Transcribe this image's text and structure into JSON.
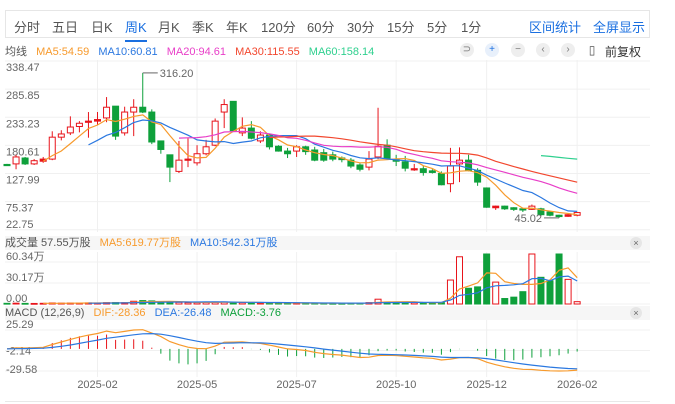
{
  "tabs": [
    {
      "label": "分时"
    },
    {
      "label": "五日"
    },
    {
      "label": "日K"
    },
    {
      "label": "周K",
      "active": true
    },
    {
      "label": "月K"
    },
    {
      "label": "季K"
    },
    {
      "label": "年K"
    },
    {
      "label": "120分"
    },
    {
      "label": "60分"
    },
    {
      "label": "30分"
    },
    {
      "label": "15分"
    },
    {
      "label": "5分"
    },
    {
      "label": "1分"
    }
  ],
  "actions": {
    "range_stats": "区间统计",
    "fullscreen": "全屏显示"
  },
  "ma_legend": {
    "title": "均线",
    "ma5": "MA5:54.59",
    "ma10": "MA10:60.81",
    "ma20": "MA20:94.61",
    "ma30": "MA30:115.55",
    "ma60": "MA60:158.14"
  },
  "controls": {
    "reset": "⊃",
    "zoom_in": "+",
    "zoom_out": "−",
    "prev": "‹",
    "next": "›",
    "bar": "▯",
    "adjust": "前复权"
  },
  "volume_header": {
    "title": "成交量 57.55万股",
    "ma5": "MA5:619.77万股",
    "ma10": "MA10:542.31万股",
    "close": "×"
  },
  "macd_header": {
    "title": "MACD (12,26,9)",
    "dif": "DIF:-28.36",
    "dea": "DEA:-26.48",
    "macd": "MACD:-3.76",
    "close": "×"
  },
  "colors": {
    "up": "#e8141b",
    "down": "#0ea03b",
    "ma5": "#f79a2c",
    "ma10": "#2b78e0",
    "ma20": "#e83ec8",
    "ma30": "#f2472e",
    "ma60": "#2fd08f",
    "accent": "#1a6fe0"
  },
  "chart_data": {
    "type": "candlestick",
    "period": "weekly",
    "price_axis": {
      "ticks": [
        "338.47",
        "285.85",
        "233.23",
        "180.61",
        "127.99",
        "75.37",
        "22.75"
      ],
      "range": [
        22.75,
        338.47
      ]
    },
    "volume_axis": {
      "ticks": [
        "60.34万",
        "30.17万",
        "0.00"
      ],
      "range": [
        0,
        60.34
      ]
    },
    "macd_axis": {
      "ticks": [
        "25.29",
        "-2.14",
        "-29.58"
      ],
      "range": [
        -29.58,
        25.29
      ]
    },
    "x_ticks": [
      {
        "label": "2025-02",
        "index": 10
      },
      {
        "label": "2025-05",
        "index": 21
      },
      {
        "label": "2025-07",
        "index": 32
      },
      {
        "label": "2025-10",
        "index": 43
      },
      {
        "label": "2025-12",
        "index": 53
      },
      {
        "label": "2026-02",
        "index": 63
      }
    ],
    "annotations": {
      "high": {
        "label": "316.20",
        "index": 15
      },
      "low": {
        "label": "45.02",
        "index": 61
      }
    },
    "ohlc": [
      [
        145,
        143,
        146,
        142
      ],
      [
        146,
        159,
        163,
        136
      ],
      [
        157,
        146,
        159,
        144
      ],
      [
        146,
        152,
        155,
        144
      ],
      [
        151,
        155,
        159,
        148
      ],
      [
        155,
        196,
        207,
        153
      ],
      [
        196,
        202,
        209,
        190
      ],
      [
        204,
        215,
        235,
        200
      ],
      [
        216,
        222,
        226,
        205
      ],
      [
        224,
        226,
        243,
        195
      ],
      [
        226,
        229,
        243,
        219
      ],
      [
        232,
        252,
        271,
        224
      ],
      [
        254,
        198,
        254,
        191
      ],
      [
        204,
        243,
        253,
        199
      ],
      [
        243,
        252,
        267,
        198
      ],
      [
        252,
        243,
        316.2,
        241
      ],
      [
        243,
        187,
        248,
        183
      ],
      [
        189,
        173,
        189,
        165
      ],
      [
        163,
        140,
        163,
        112
      ],
      [
        132,
        153,
        189,
        129
      ],
      [
        153,
        155,
        194,
        140
      ],
      [
        148,
        165,
        181,
        143
      ],
      [
        165,
        178,
        191,
        162
      ],
      [
        181,
        226,
        231,
        179
      ],
      [
        243,
        257,
        267,
        213
      ],
      [
        263,
        208,
        263,
        206
      ],
      [
        204,
        213,
        233,
        198
      ],
      [
        213,
        194,
        226,
        192
      ],
      [
        189,
        200,
        207,
        185
      ],
      [
        200,
        178,
        202,
        173
      ],
      [
        179,
        170,
        181,
        169
      ],
      [
        170,
        165,
        176,
        157
      ],
      [
        170,
        178,
        181,
        159
      ],
      [
        178,
        169,
        180,
        163
      ],
      [
        172,
        153,
        178,
        151
      ],
      [
        167,
        153,
        174,
        150
      ],
      [
        163,
        155,
        169,
        151
      ],
      [
        157,
        154,
        160,
        149
      ],
      [
        153,
        142,
        157,
        138
      ],
      [
        144,
        136,
        147,
        132
      ],
      [
        140,
        155,
        170,
        134
      ],
      [
        159,
        179,
        251,
        155
      ],
      [
        181,
        157,
        192,
        155
      ],
      [
        155,
        151,
        163,
        142
      ],
      [
        150,
        138,
        161,
        132
      ],
      [
        135,
        137,
        146,
        133
      ],
      [
        137,
        130,
        142,
        124
      ],
      [
        133,
        130,
        136,
        128
      ],
      [
        128,
        107,
        132,
        106
      ],
      [
        109,
        142,
        176,
        93
      ],
      [
        146,
        153,
        177,
        112
      ],
      [
        153,
        134,
        163,
        132
      ],
      [
        134,
        112,
        138,
        105
      ],
      [
        101,
        65,
        102,
        64
      ],
      [
        64,
        67,
        68,
        60
      ],
      [
        67,
        62,
        68,
        60
      ],
      [
        64,
        61,
        65,
        58
      ],
      [
        62,
        60,
        64,
        56
      ],
      [
        61,
        67,
        70,
        60
      ],
      [
        62,
        51,
        64,
        49
      ],
      [
        56,
        50,
        58,
        48
      ],
      [
        50,
        47.5,
        51,
        45.02
      ],
      [
        48,
        51,
        53,
        47
      ],
      [
        50,
        55,
        56,
        48
      ]
    ],
    "volume": [
      1.0,
      1.2,
      0.9,
      0.8,
      1.0,
      1.5,
      1.2,
      1.4,
      1.3,
      1.6,
      1.5,
      2.0,
      2.2,
      2.0,
      4.0,
      5.0,
      4.5,
      2.5,
      3.0,
      2.5,
      2.0,
      2.0,
      2.5,
      3.0,
      3.0,
      2.5,
      2.0,
      2.0,
      1.5,
      1.5,
      1.5,
      1.2,
      1.5,
      1.5,
      1.2,
      1.2,
      1.0,
      1.0,
      1.2,
      1.2,
      2.0,
      7.0,
      3.0,
      2.5,
      2.0,
      2.0,
      1.8,
      1.5,
      2.0,
      35,
      69,
      23,
      25,
      75,
      32,
      8,
      10,
      18,
      75,
      39,
      34,
      80,
      36,
      3.4
    ],
    "ma_periods": [
      5,
      10,
      20,
      30,
      60
    ],
    "grid": true
  }
}
